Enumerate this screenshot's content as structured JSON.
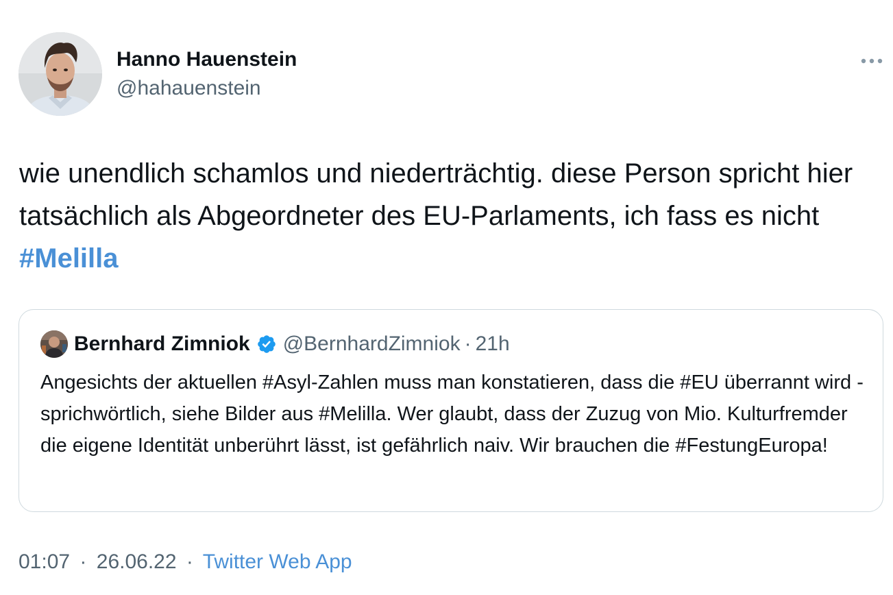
{
  "author": {
    "display_name": "Hanno Hauenstein",
    "handle": "@hahauenstein",
    "avatar_icon": "profile-photo"
  },
  "menu": {
    "more_icon": "ellipsis-icon"
  },
  "tweet": {
    "text_before": "wie unendlich schamlos und niederträchtig. diese Person spricht hier tatsächlich als Abgeordneter des EU-Parlaments, ich fass es nicht ",
    "hashtag": "#Melilla"
  },
  "quoted": {
    "display_name": "Bernhard Zimniok",
    "verified_icon": "verified-badge-icon",
    "handle": "@BernhardZimniok",
    "separator": "·",
    "time": "21h",
    "text": "Angesichts der aktuellen #Asyl-Zahlen muss man konstatieren, dass die #EU überrannt wird - sprichwörtlich, siehe Bilder aus #Melilla. Wer glaubt, dass der Zuzug von Mio. Kulturfremder die eigene Identität unberührt lässt, ist gefährlich naiv. Wir brauchen die #FestungEuropa!"
  },
  "meta": {
    "time": "01:07",
    "date": "26.06.22",
    "separator": "·",
    "source": "Twitter Web App"
  },
  "colors": {
    "text": "#0f1419",
    "muted": "#536471",
    "link": "#4a90d6",
    "border": "#cfd9de",
    "verified": "#1d9bf0"
  }
}
